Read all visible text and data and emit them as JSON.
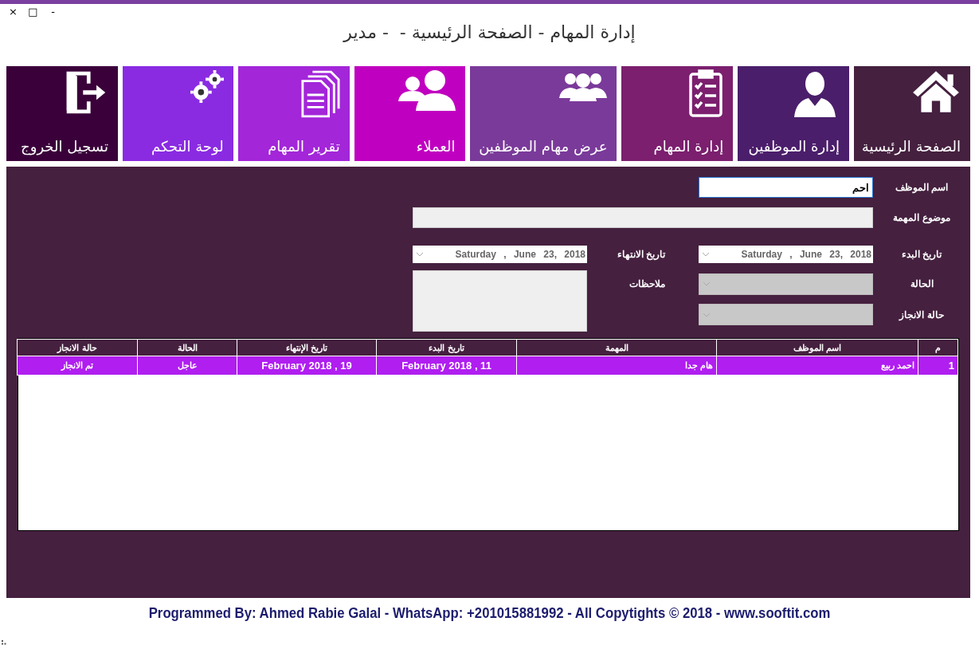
{
  "window": {
    "title": "إدارة المهام - الصفحة الرئيسية -  - مدير",
    "controls": [
      "-",
      "□",
      "×"
    ]
  },
  "tiles": [
    {
      "label": "الصفحة الرئيسية",
      "color": "#45203f"
    },
    {
      "label": "إدارة الموظفين",
      "color": "#4b1e6b"
    },
    {
      "label": "إدارة المهام",
      "color": "#7b1f6e"
    },
    {
      "label": "عرض مهام الموظفين",
      "color": "#7a3a9a"
    },
    {
      "label": "العملاء",
      "color": "#c000c0"
    },
    {
      "label": "تقرير المهام",
      "color": "#a326d9"
    },
    {
      "label": "لوحة التحكم",
      "color": "#8a2be2"
    },
    {
      "label": "تسجيل الخروج",
      "color": "#3a003a"
    }
  ],
  "form": {
    "employee_name": {
      "label": "اسم الموظف",
      "value": "احم"
    },
    "task_subject": {
      "label": "موضوع المهمة"
    },
    "start_date": {
      "label": "تاريخ البدء",
      "value": "Saturday , June 23, 2018"
    },
    "end_date": {
      "label": "تاريخ الانتهاء",
      "value": "Saturday , June 23, 2018"
    },
    "status": {
      "label": "الحالة",
      "disabled": true
    },
    "notes": {
      "label": "ملاحظات"
    },
    "completion_status": {
      "label": "حالة الانجاز",
      "disabled": true
    }
  },
  "table": {
    "columns": [
      "م",
      "اسم الموظف",
      "المهمة",
      "تاريخ البدء",
      "تاريخ الإنتهاء",
      "الحالة",
      "حالة الانجاز"
    ],
    "rows": [
      {
        "selected": true,
        "cells": [
          "1",
          "احمد ربيع",
          "هام جدا",
          "February 2018 , 11",
          "February 2018 , 19",
          "عاجل",
          "تم الانجاز"
        ]
      }
    ]
  },
  "footer": "Programmed By: Ahmed Rabie Galal - WhatsApp: +201015881992 - All Copytights © 2018 - www.sooftit.com"
}
